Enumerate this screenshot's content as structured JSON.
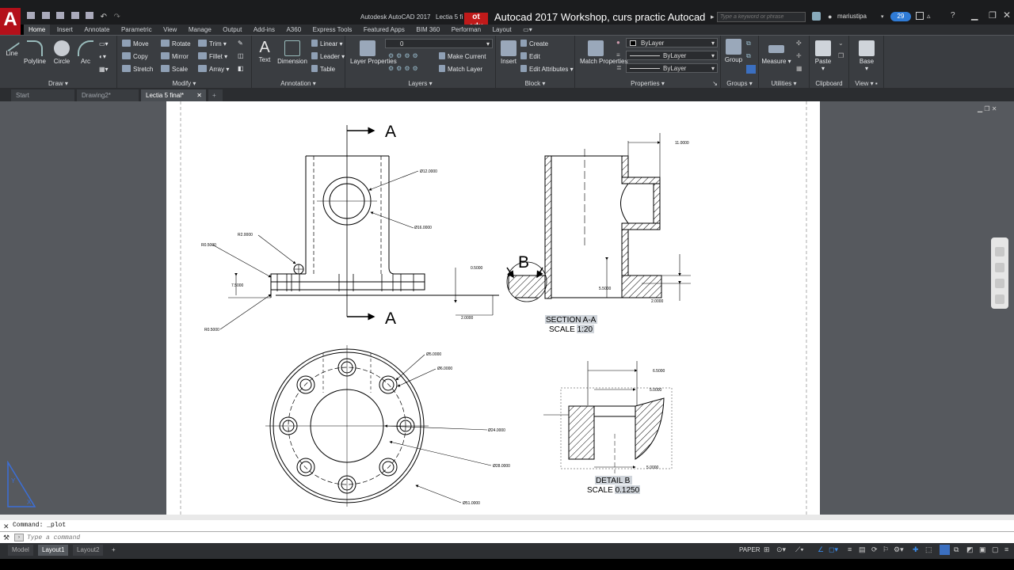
{
  "title_bar": {
    "app_title": "Autodesk AutoCAD 2017",
    "file_title": "Lectia 5 fi",
    "overlay_title": "Autocad 2017 Workshop, curs practic Autocad",
    "search_placeholder": "Type a keyword or phrase",
    "user": "mariustipa",
    "notification_count": "29"
  },
  "ribbon_tabs": [
    "Home",
    "Insert",
    "Annotate",
    "Parametric",
    "View",
    "Manage",
    "Output",
    "Add-ins",
    "A360",
    "Express Tools",
    "Featured Apps",
    "BIM 360",
    "Performan",
    "Layout"
  ],
  "ribbon": {
    "draw": {
      "title": "Draw",
      "line": "Line",
      "polyline": "Polyline",
      "circle": "Circle",
      "arc": "Arc"
    },
    "modify": {
      "title": "Modify",
      "move": "Move",
      "rotate": "Rotate",
      "trim": "Trim",
      "copy": "Copy",
      "mirror": "Mirror",
      "fillet": "Fillet",
      "stretch": "Stretch",
      "scale": "Scale",
      "array": "Array"
    },
    "annotation": {
      "title": "Annotation",
      "text": "Text",
      "dimension": "Dimension",
      "linear": "Linear",
      "leader": "Leader",
      "table": "Table"
    },
    "layers": {
      "title": "Layers",
      "layer_properties": "Layer Properties",
      "current_layer": "0",
      "make_current": "Make Current",
      "match_layer": "Match Layer"
    },
    "block": {
      "title": "Block",
      "insert": "Insert",
      "create": "Create",
      "edit": "Edit",
      "edit_attributes": "Edit Attributes"
    },
    "properties": {
      "title": "Properties",
      "match_properties": "Match Properties",
      "color": "ByLayer",
      "linetype": "ByLayer",
      "lineweight": "ByLayer"
    },
    "groups": {
      "title": "Groups",
      "group": "Group"
    },
    "utilities": {
      "title": "Utilities",
      "measure": "Measure"
    },
    "clipboard": {
      "title": "Clipboard",
      "paste": "Paste"
    },
    "view": {
      "title": "View",
      "base": "Base"
    }
  },
  "doc_tabs": [
    "Start",
    "Drawing2*",
    "Lectia 5 final*"
  ],
  "drawing": {
    "section_label_top": "A",
    "section_label_bottom": "A",
    "detail_marker": "B",
    "dim_d12": "Ø12.0000",
    "dim_d16": "Ø16.0000",
    "dim_r2": "R2.0000",
    "dim_r0_5": "R0.5000",
    "dim_7_5": "7.5000",
    "dim_r0_5b": "R0.5000",
    "dim_0_5": "0.5000",
    "dim_2_0": "2.0000",
    "dim_11": "11.0000",
    "dim_5_5": "5.5000",
    "dim_2_0b": "2.0000",
    "section_title": "SECTION A-A",
    "section_scale": "SCALE 1:20",
    "dim_d5": "Ø5.0000",
    "dim_d6": "Ø6.0000",
    "dim_d24": "Ø24.0000",
    "dim_d28": "Ø28.0000",
    "dim_d51": "Ø51.0000",
    "dim_6_5": "6.5000",
    "dim_5_0a": "5.0000",
    "dim_5_0b": "5.0000",
    "detail_title": "DETAIL B",
    "detail_scale": "SCALE 0.1250"
  },
  "command": {
    "history": "Command: _plot",
    "placeholder": "Type a command"
  },
  "layout_tabs": [
    "Model",
    "Layout1",
    "Layout2"
  ],
  "status": {
    "space": "PAPER"
  }
}
